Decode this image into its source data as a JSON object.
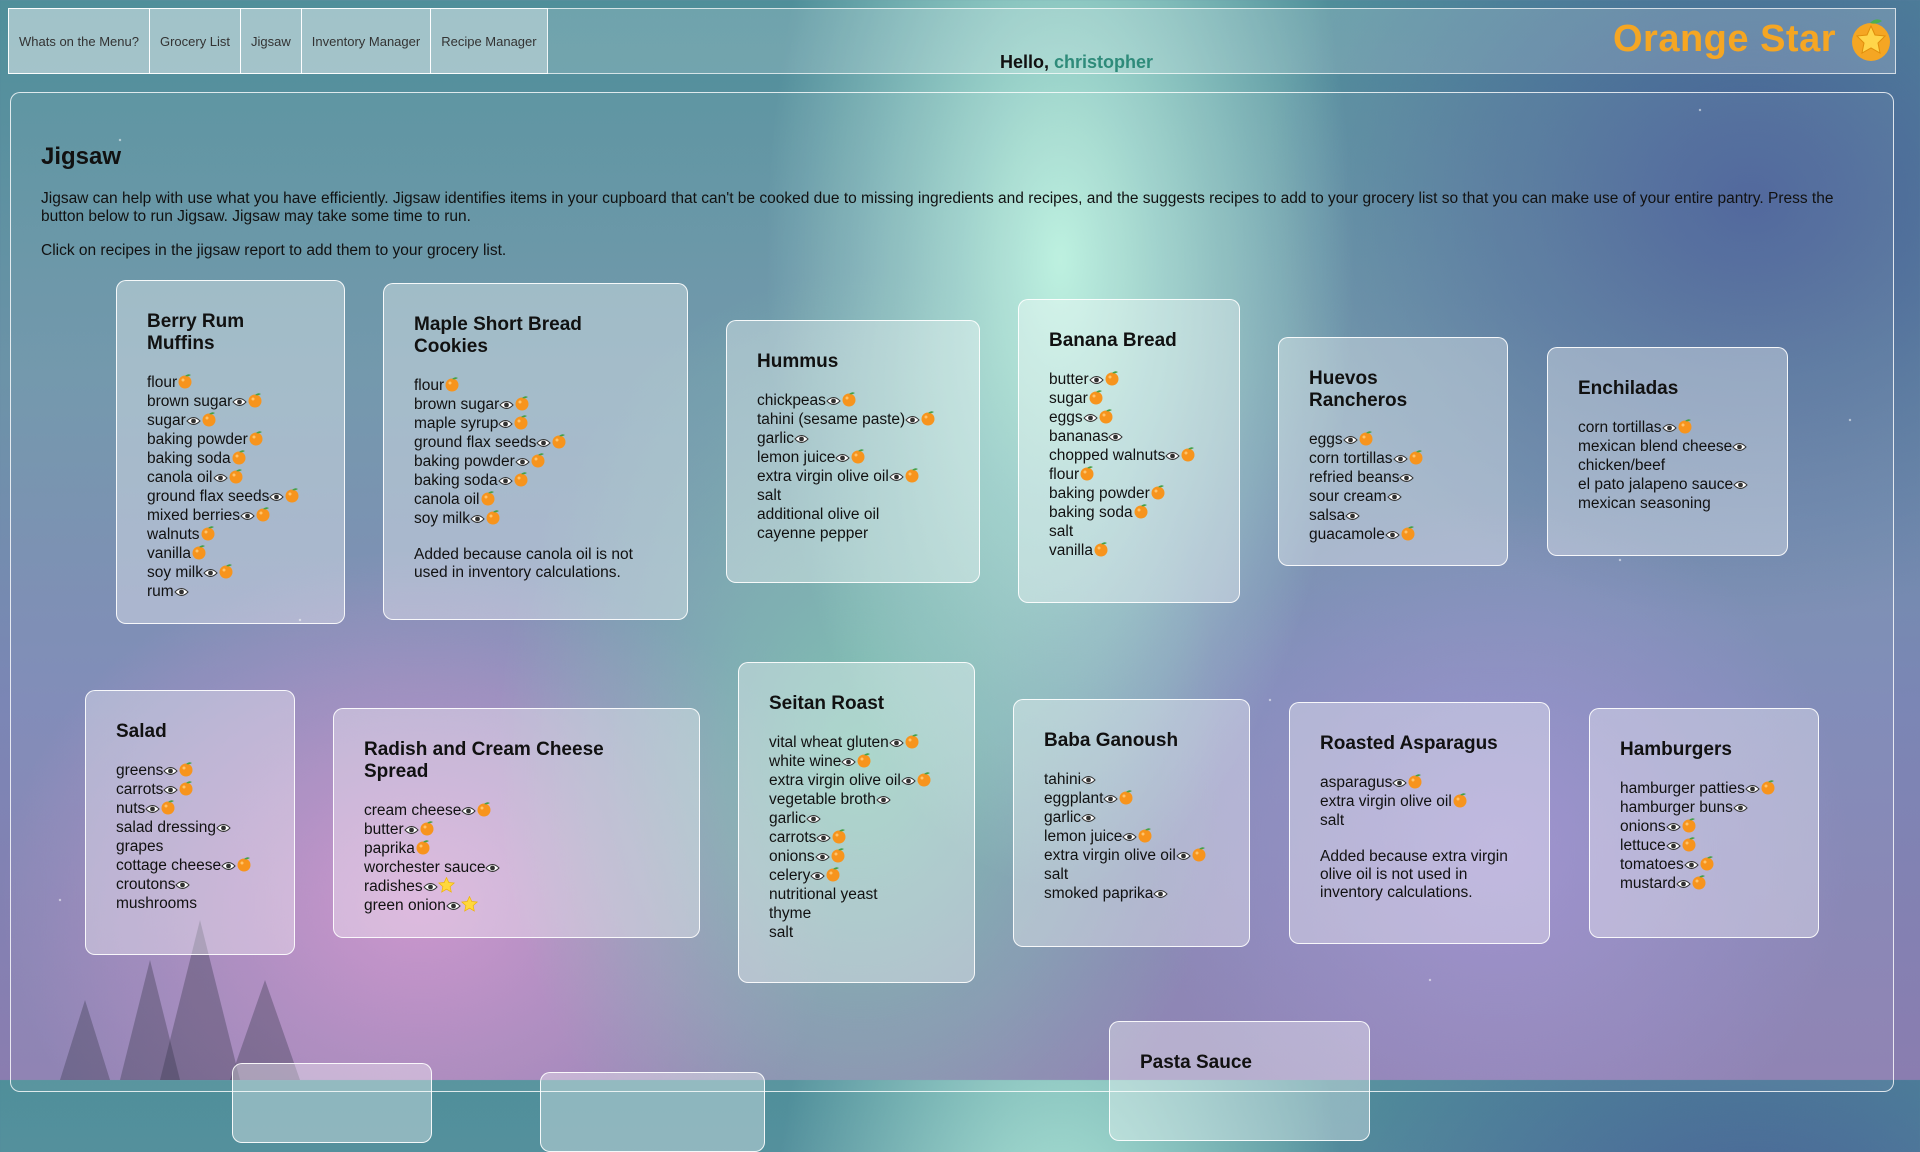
{
  "nav": [
    {
      "label": "Whats on the Menu?"
    },
    {
      "label": "Grocery List"
    },
    {
      "label": "Jigsaw"
    },
    {
      "label": "Inventory Manager"
    },
    {
      "label": "Recipe Manager"
    }
  ],
  "brand": {
    "name": "Orange Star"
  },
  "greeting": {
    "hello": "Hello,",
    "user": "christopher"
  },
  "page": {
    "title": "Jigsaw",
    "intro": "Jigsaw can help with use what you have efficiently. Jigsaw identifies items in your cupboard that can't be cooked due to missing ingredients and recipes, and the suggests recipes to add to your grocery list so that you can make use of your entire pantry. Press the button below to run Jigsaw. Jigsaw may take some time to run.",
    "hint": "Click on recipes in the jigsaw report to add them to your grocery list."
  },
  "colors": {
    "brand": "#f5a623",
    "user": "#2e8b7a"
  },
  "icons": {
    "eye": "eye-icon",
    "orange": "orange-icon",
    "star": "star-icon"
  },
  "recipes": [
    {
      "title": "Berry Rum Muffins",
      "items": [
        {
          "name": "flour",
          "icons": [
            "orange"
          ]
        },
        {
          "name": "brown sugar",
          "icons": [
            "eye",
            "orange"
          ]
        },
        {
          "name": "sugar",
          "icons": [
            "eye",
            "orange"
          ]
        },
        {
          "name": "baking powder",
          "icons": [
            "orange"
          ]
        },
        {
          "name": "baking soda",
          "icons": [
            "orange"
          ]
        },
        {
          "name": "canola oil",
          "icons": [
            "eye",
            "orange"
          ]
        },
        {
          "name": "ground flax seeds",
          "icons": [
            "eye",
            "orange"
          ]
        },
        {
          "name": "mixed berries",
          "icons": [
            "eye",
            "orange"
          ]
        },
        {
          "name": "walnuts",
          "icons": [
            "orange"
          ]
        },
        {
          "name": "vanilla",
          "icons": [
            "orange"
          ]
        },
        {
          "name": "soy milk",
          "icons": [
            "eye",
            "orange"
          ]
        },
        {
          "name": "rum",
          "icons": [
            "eye"
          ]
        }
      ]
    },
    {
      "title": "Maple Short Bread Cookies",
      "items": [
        {
          "name": "flour",
          "icons": [
            "orange"
          ]
        },
        {
          "name": "brown sugar",
          "icons": [
            "eye",
            "orange"
          ]
        },
        {
          "name": "maple syrup",
          "icons": [
            "eye",
            "orange"
          ]
        },
        {
          "name": "ground flax seeds",
          "icons": [
            "eye",
            "orange"
          ]
        },
        {
          "name": "baking powder",
          "icons": [
            "eye",
            "orange"
          ]
        },
        {
          "name": "baking soda",
          "icons": [
            "eye",
            "orange"
          ]
        },
        {
          "name": "canola oil",
          "icons": [
            "orange"
          ]
        },
        {
          "name": "soy milk",
          "icons": [
            "eye",
            "orange"
          ]
        }
      ],
      "note": "Added because canola oil is not used in inventory calculations."
    },
    {
      "title": "Hummus",
      "items": [
        {
          "name": "chickpeas",
          "icons": [
            "eye",
            "orange"
          ]
        },
        {
          "name": "tahini (sesame paste)",
          "icons": [
            "eye",
            "orange"
          ]
        },
        {
          "name": "garlic",
          "icons": [
            "eye"
          ]
        },
        {
          "name": "lemon juice",
          "icons": [
            "eye",
            "orange"
          ]
        },
        {
          "name": "extra virgin olive oil",
          "icons": [
            "eye",
            "orange"
          ]
        },
        {
          "name": "salt",
          "icons": []
        },
        {
          "name": "additional olive oil",
          "icons": []
        },
        {
          "name": "cayenne pepper",
          "icons": []
        }
      ]
    },
    {
      "title": "Banana Bread",
      "items": [
        {
          "name": "butter",
          "icons": [
            "eye",
            "orange"
          ]
        },
        {
          "name": "sugar",
          "icons": [
            "orange"
          ]
        },
        {
          "name": "eggs",
          "icons": [
            "eye",
            "orange"
          ]
        },
        {
          "name": "bananas",
          "icons": [
            "eye"
          ]
        },
        {
          "name": "chopped walnuts",
          "icons": [
            "eye",
            "orange"
          ]
        },
        {
          "name": "flour",
          "icons": [
            "orange"
          ]
        },
        {
          "name": "baking powder",
          "icons": [
            "orange"
          ]
        },
        {
          "name": "baking soda",
          "icons": [
            "orange"
          ]
        },
        {
          "name": "salt",
          "icons": []
        },
        {
          "name": "vanilla",
          "icons": [
            "orange"
          ]
        }
      ]
    },
    {
      "title": "Huevos Rancheros",
      "items": [
        {
          "name": "eggs",
          "icons": [
            "eye",
            "orange"
          ]
        },
        {
          "name": "corn tortillas",
          "icons": [
            "eye",
            "orange"
          ]
        },
        {
          "name": "refried beans",
          "icons": [
            "eye"
          ]
        },
        {
          "name": "sour cream",
          "icons": [
            "eye"
          ]
        },
        {
          "name": "salsa",
          "icons": [
            "eye"
          ]
        },
        {
          "name": "guacamole",
          "icons": [
            "eye",
            "orange"
          ]
        }
      ]
    },
    {
      "title": "Enchiladas",
      "items": [
        {
          "name": "corn tortillas",
          "icons": [
            "eye",
            "orange"
          ]
        },
        {
          "name": "mexican blend cheese",
          "icons": [
            "eye"
          ]
        },
        {
          "name": "chicken/beef",
          "icons": []
        },
        {
          "name": "el pato jalapeno sauce",
          "icons": [
            "eye"
          ]
        },
        {
          "name": "mexican seasoning",
          "icons": []
        }
      ]
    },
    {
      "title": "Salad",
      "items": [
        {
          "name": "greens",
          "icons": [
            "eye",
            "orange"
          ]
        },
        {
          "name": "carrots",
          "icons": [
            "eye",
            "orange"
          ]
        },
        {
          "name": "nuts",
          "icons": [
            "eye",
            "orange"
          ]
        },
        {
          "name": "salad dressing",
          "icons": [
            "eye"
          ]
        },
        {
          "name": "grapes",
          "icons": []
        },
        {
          "name": "cottage cheese",
          "icons": [
            "eye",
            "orange"
          ]
        },
        {
          "name": "croutons",
          "icons": [
            "eye"
          ]
        },
        {
          "name": "mushrooms",
          "icons": []
        }
      ]
    },
    {
      "title": "Radish and Cream Cheese Spread",
      "items": [
        {
          "name": "cream cheese",
          "icons": [
            "eye",
            "orange"
          ]
        },
        {
          "name": "butter",
          "icons": [
            "eye",
            "orange"
          ]
        },
        {
          "name": "paprika",
          "icons": [
            "orange"
          ]
        },
        {
          "name": "worchester sauce",
          "icons": [
            "eye"
          ]
        },
        {
          "name": "radishes",
          "icons": [
            "eye",
            "star"
          ]
        },
        {
          "name": "green onion",
          "icons": [
            "eye",
            "star"
          ]
        }
      ]
    },
    {
      "title": "Seitan Roast",
      "items": [
        {
          "name": "vital wheat gluten",
          "icons": [
            "eye",
            "orange"
          ]
        },
        {
          "name": "white wine",
          "icons": [
            "eye",
            "orange"
          ]
        },
        {
          "name": "extra virgin olive oil",
          "icons": [
            "eye",
            "orange"
          ]
        },
        {
          "name": "vegetable broth",
          "icons": [
            "eye"
          ]
        },
        {
          "name": "garlic",
          "icons": [
            "eye"
          ]
        },
        {
          "name": "carrots",
          "icons": [
            "eye",
            "orange"
          ]
        },
        {
          "name": "onions",
          "icons": [
            "eye",
            "orange"
          ]
        },
        {
          "name": "celery",
          "icons": [
            "eye",
            "orange"
          ]
        },
        {
          "name": "nutritional yeast",
          "icons": []
        },
        {
          "name": "thyme",
          "icons": []
        },
        {
          "name": "salt",
          "icons": []
        }
      ]
    },
    {
      "title": "Baba Ganoush",
      "items": [
        {
          "name": "tahini",
          "icons": [
            "eye"
          ]
        },
        {
          "name": "eggplant",
          "icons": [
            "eye",
            "orange"
          ]
        },
        {
          "name": "garlic",
          "icons": [
            "eye"
          ]
        },
        {
          "name": "lemon juice",
          "icons": [
            "eye",
            "orange"
          ]
        },
        {
          "name": "extra virgin olive oil",
          "icons": [
            "eye",
            "orange"
          ]
        },
        {
          "name": "salt",
          "icons": []
        },
        {
          "name": "smoked paprika",
          "icons": [
            "eye"
          ]
        }
      ]
    },
    {
      "title": "Roasted Asparagus",
      "items": [
        {
          "name": "asparagus",
          "icons": [
            "eye",
            "orange"
          ]
        },
        {
          "name": "extra virgin olive oil",
          "icons": [
            "orange"
          ]
        },
        {
          "name": "salt",
          "icons": []
        }
      ],
      "note": "Added because extra virgin olive oil is not used in inventory calculations."
    },
    {
      "title": "Hamburgers",
      "items": [
        {
          "name": "hamburger patties",
          "icons": [
            "eye",
            "orange"
          ]
        },
        {
          "name": "hamburger buns",
          "icons": [
            "eye"
          ]
        },
        {
          "name": "onions",
          "icons": [
            "eye",
            "orange"
          ]
        },
        {
          "name": "lettuce",
          "icons": [
            "eye",
            "orange"
          ]
        },
        {
          "name": "tomatoes",
          "icons": [
            "eye",
            "orange"
          ]
        },
        {
          "name": "mustard",
          "icons": [
            "eye",
            "orange"
          ]
        }
      ]
    },
    {
      "title": "Pasta Sauce",
      "items": []
    },
    {
      "title": "",
      "items": []
    },
    {
      "title": "",
      "items": []
    }
  ]
}
